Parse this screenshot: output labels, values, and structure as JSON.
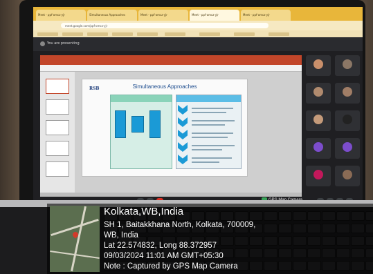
{
  "browser": {
    "tabs": [
      "Meet - ppf-omcz-yjr",
      "Simultaneous Approaches",
      "Meet - ppf-omcz-yjr",
      "Meet - ppf-omcz-yjr",
      "Meet - ppf-omcz-yjr"
    ],
    "url": "meet.google.com/ppf-omcz-yjr"
  },
  "meet": {
    "presenting_label": "You are presenting"
  },
  "slide": {
    "logo": "RSB",
    "title": "Simultaneous Approaches",
    "left_header": "",
    "right_header": ""
  },
  "participants": [
    {
      "name": "",
      "avatar_color": "#c98f6b"
    },
    {
      "name": "",
      "avatar_color": "#8b7766"
    },
    {
      "name": "",
      "avatar_color": "#b08a6e"
    },
    {
      "name": "",
      "avatar_color": "#a07d66"
    },
    {
      "name": "",
      "avatar_color": "#c49a7a"
    },
    {
      "name": "",
      "avatar_color": "#222222"
    },
    {
      "name": "",
      "avatar_color": "#7c4dcc"
    },
    {
      "name": "",
      "avatar_color": "#7c4dcc"
    },
    {
      "name": "",
      "avatar_color": "#c2185b"
    },
    {
      "name": "",
      "avatar_color": "#8a6b55"
    }
  ],
  "gps_camera_badge": "GPS Map Camera",
  "gps_overlay": {
    "title": "Kolkata,WB,India",
    "address_line1": "SH 1, Baitakkhana North, Kolkata, 700009,",
    "address_line2": "WB, India",
    "coords": "Lat 22.574832, Long 88.372957",
    "datetime": "09/03/2024 11:01 AM GMT+05:30",
    "note": "Note : Captured by GPS Map Camera"
  }
}
